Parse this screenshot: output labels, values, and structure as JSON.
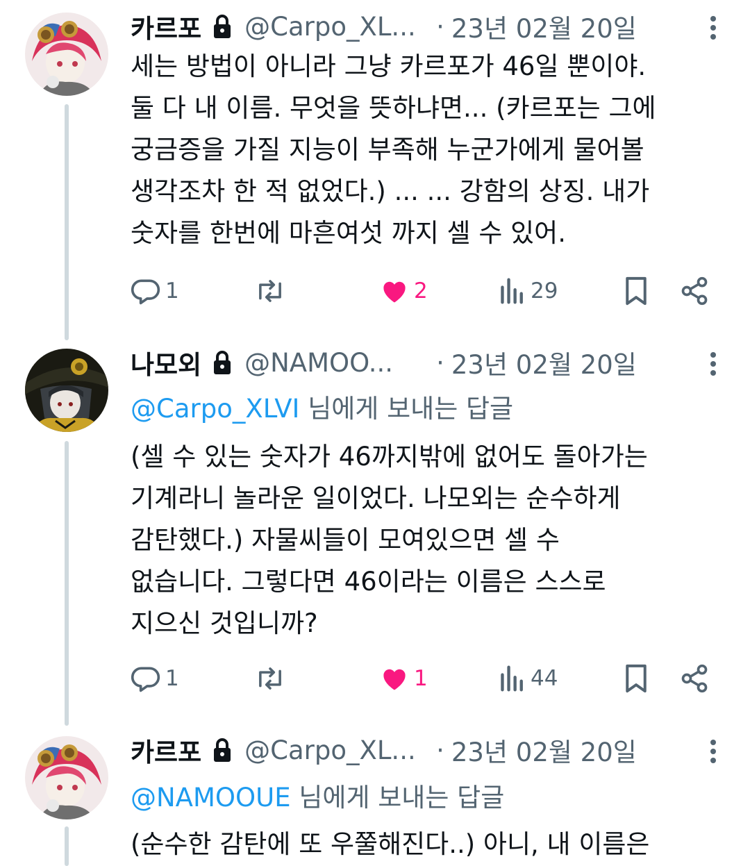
{
  "tweets": [
    {
      "display_name": "카르포",
      "handle": "@Carpo_XL...",
      "separator": "·",
      "date": "23년 02월 20일",
      "reply_to": null,
      "body_lines": [
        "세는 방법이 아니라 그냥 카르포가 46일 뿐이야.",
        "둘 다 내 이름. 무엇을 뜻하냐면... (카르포는 그에",
        "궁금증을 가질 지능이 부족해 누군가에게 물어볼",
        "생각조차 한 적 없었다.) ... ... 강함의 상징. 내가",
        "숫자를 한번에 마흔여섯 까지 셀 수 있어."
      ],
      "replies": "1",
      "likes": "2",
      "views": "29",
      "liked": true
    },
    {
      "display_name": "나모외",
      "handle": "@NAMOO...",
      "separator": "·",
      "date": "23년 02월 20일",
      "reply_to": {
        "mention": "@Carpo_XLVI",
        "suffix": " 님에게 보내는 답글"
      },
      "body_lines": [
        "(셀 수 있는 숫자가 46까지밖에 없어도 돌아가는",
        "기계라니 놀라운 일이었다. 나모외는 순수하게",
        "감탄했다.) 자물씨들이 모여있으면 셀 수",
        "없습니다. 그렇다면 46이라는 이름은 스스로",
        "지으신 것입니까?"
      ],
      "replies": "1",
      "likes": "1",
      "views": "44",
      "liked": true
    },
    {
      "display_name": "카르포",
      "handle": "@Carpo_XL...",
      "separator": "·",
      "date": "23년 02월 20일",
      "reply_to": {
        "mention": "@NAMOOUE",
        "suffix": " 님에게 보내는 답글"
      },
      "body_lines": [
        "(순수한 감탄에 또 우쭐해진다..) 아니, 내 이름은"
      ]
    }
  ],
  "colors": {
    "text": "#0f1419",
    "secondary": "#536471",
    "mention": "#1d9bf0",
    "like": "#f91880",
    "thread_line": "#cfd9de"
  },
  "icons": {
    "reply": "reply-icon",
    "retweet": "retweet-icon",
    "like": "heart-icon",
    "views": "views-icon",
    "bookmark": "bookmark-icon",
    "share": "share-icon",
    "lock": "lock-icon",
    "more": "more-icon"
  }
}
